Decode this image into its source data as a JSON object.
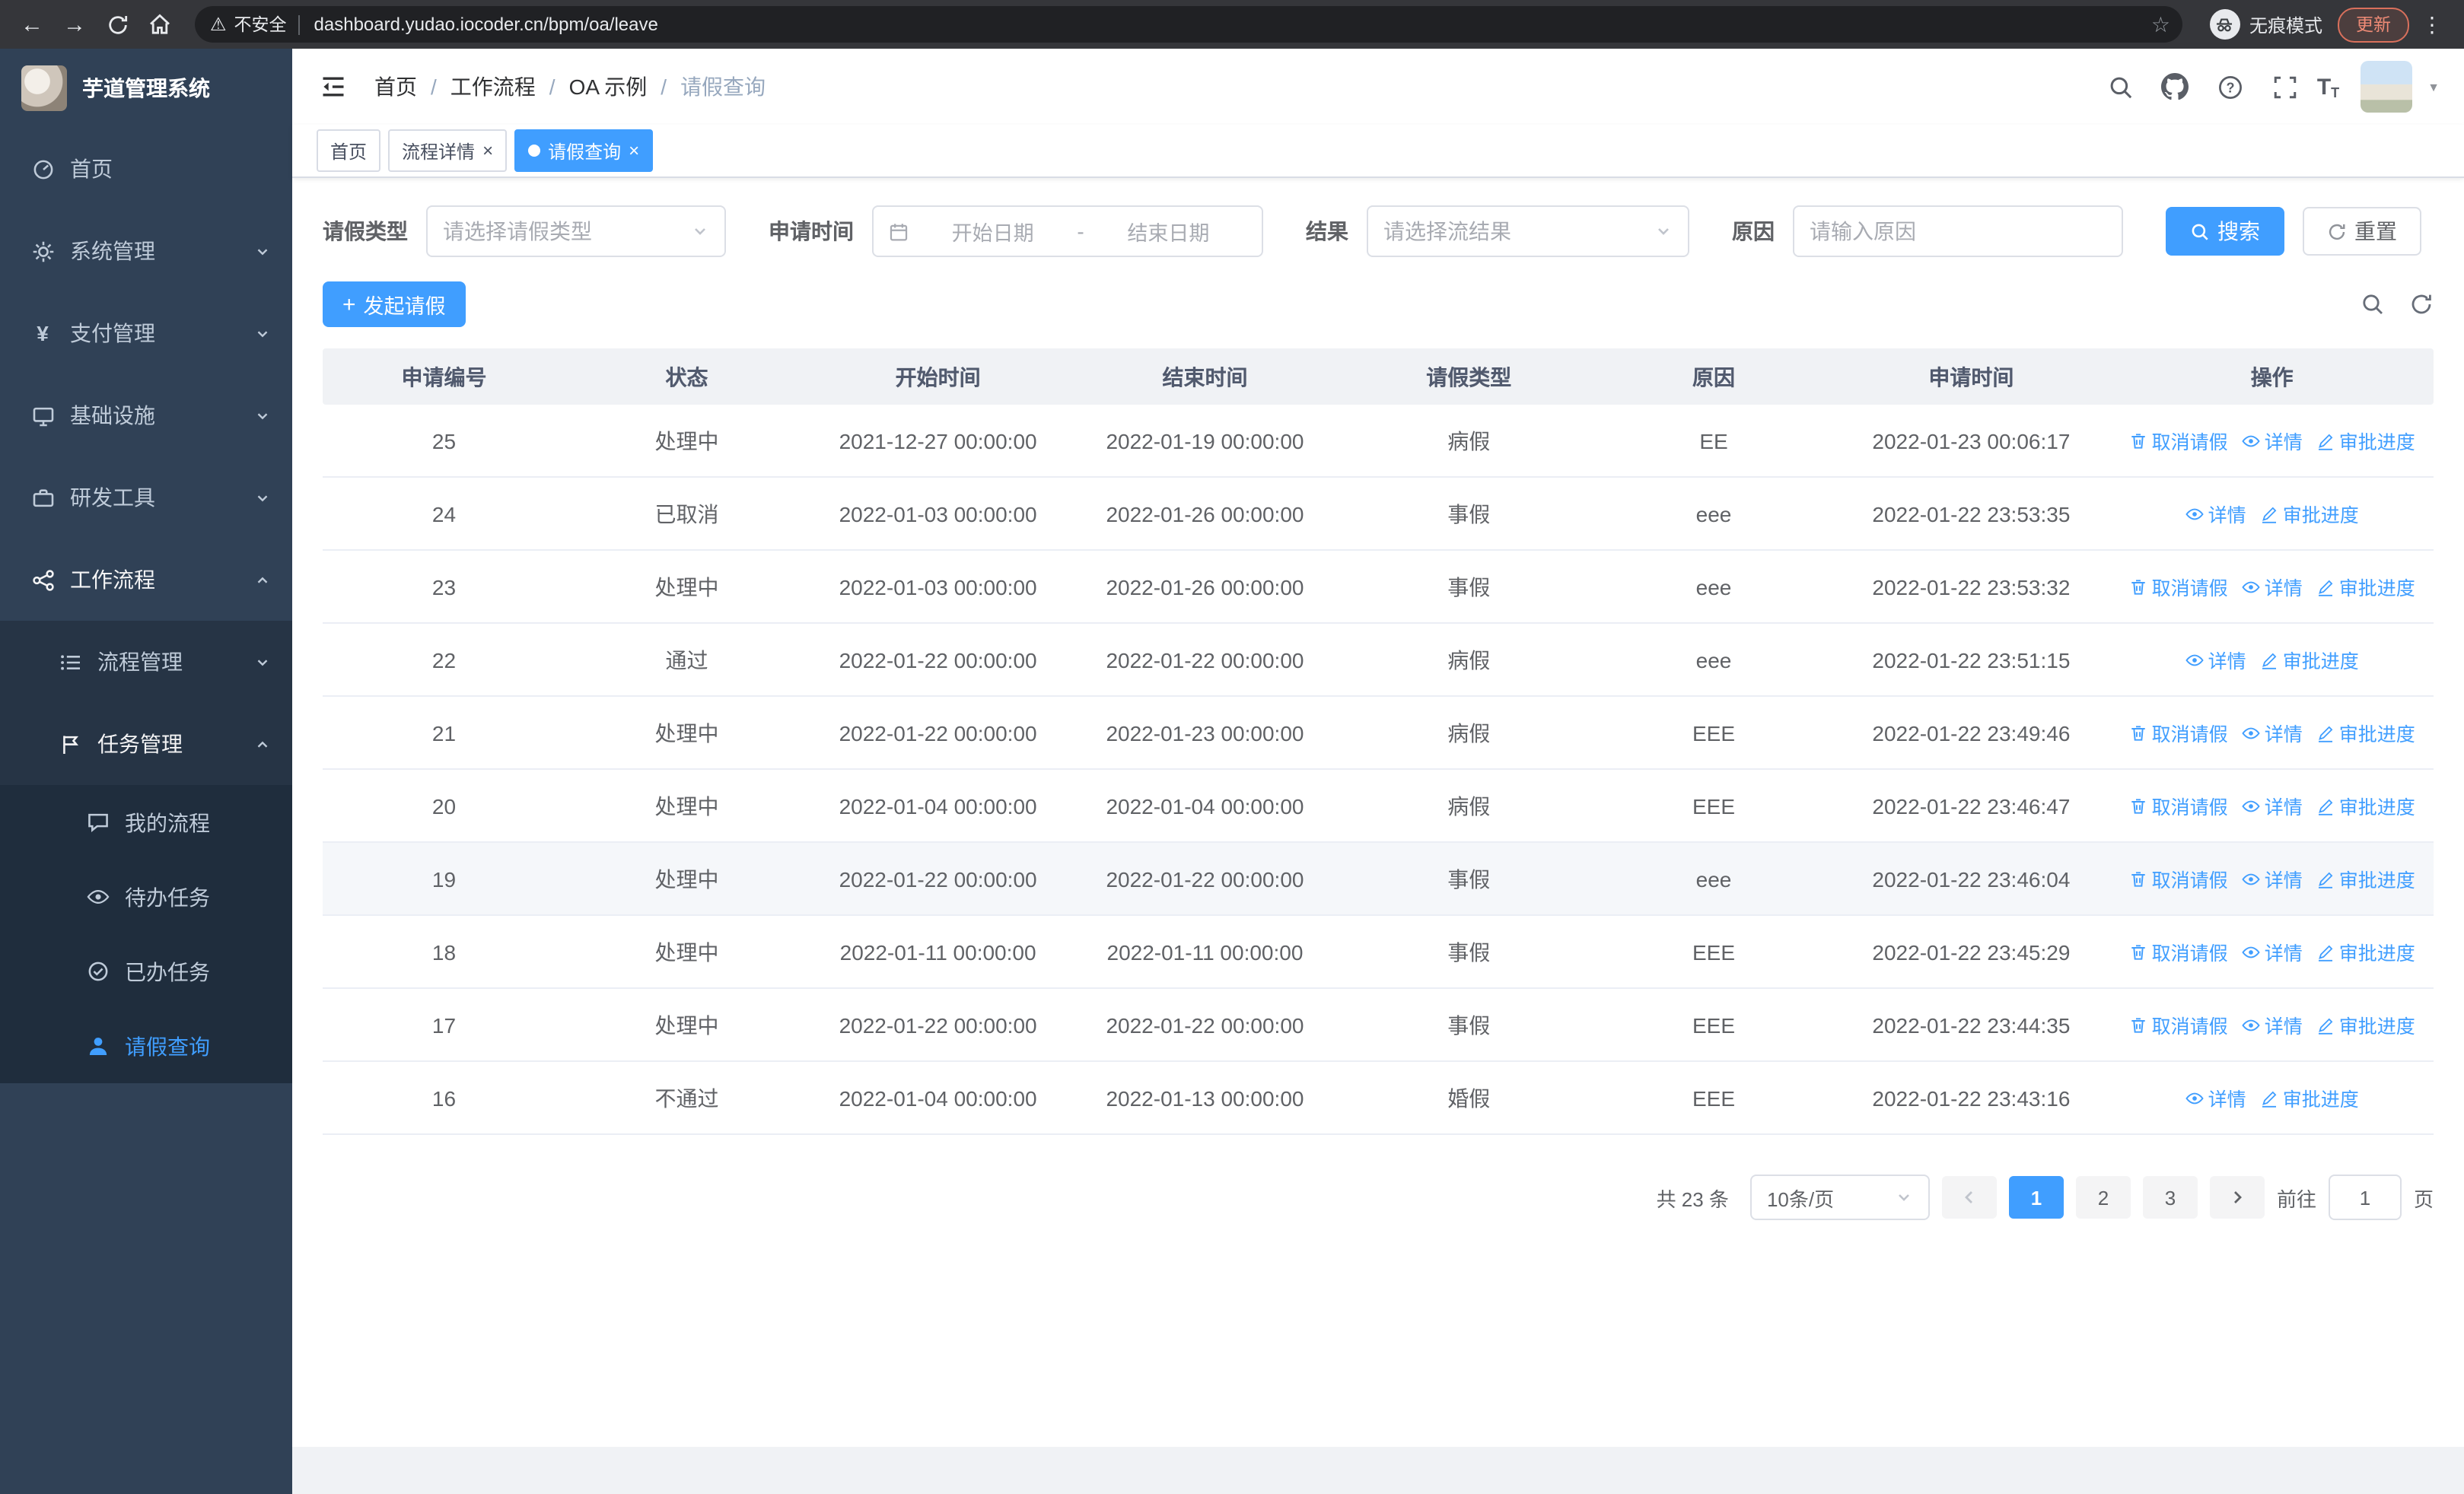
{
  "browser": {
    "security_label": "不安全",
    "url": "dashboard.yudao.iocoder.cn/bpm/oa/leave",
    "incognito_label": "无痕模式",
    "update_label": "更新"
  },
  "sidebar": {
    "logo_title": "芋道管理系统",
    "items": [
      {
        "label": "首页",
        "icon": "dashboard-icon"
      },
      {
        "label": "系统管理",
        "icon": "gear-icon"
      },
      {
        "label": "支付管理",
        "icon": "yen-icon"
      },
      {
        "label": "基础设施",
        "icon": "monitor-icon"
      },
      {
        "label": "研发工具",
        "icon": "briefcase-icon"
      },
      {
        "label": "工作流程",
        "icon": "workflow-icon"
      }
    ],
    "workflow_children": [
      {
        "label": "流程管理",
        "icon": "list-icon"
      },
      {
        "label": "任务管理",
        "icon": "flag-icon"
      }
    ],
    "task_children": [
      {
        "label": "我的流程",
        "icon": "chat-icon"
      },
      {
        "label": "待办任务",
        "icon": "eye-icon"
      },
      {
        "label": "已办任务",
        "icon": "check-circle-icon"
      },
      {
        "label": "请假查询",
        "icon": "user-icon"
      }
    ]
  },
  "header": {
    "breadcrumb": [
      "首页",
      "工作流程",
      "OA 示例",
      "请假查询"
    ]
  },
  "tabs": [
    {
      "label": "首页"
    },
    {
      "label": "流程详情"
    },
    {
      "label": "请假查询"
    }
  ],
  "filters": {
    "leave_type_label": "请假类型",
    "leave_type_placeholder": "请选择请假类型",
    "apply_time_label": "申请时间",
    "start_date_placeholder": "开始日期",
    "range_separator": "-",
    "end_date_placeholder": "结束日期",
    "result_label": "结果",
    "result_placeholder": "请选择流结果",
    "reason_label": "原因",
    "reason_placeholder": "请输入原因",
    "search_button": "搜索",
    "reset_button": "重置"
  },
  "toolbar": {
    "create_button": "发起请假"
  },
  "table": {
    "columns": [
      "申请编号",
      "状态",
      "开始时间",
      "结束时间",
      "请假类型",
      "原因",
      "申请时间",
      "操作"
    ],
    "actions": {
      "cancel": "取消请假",
      "detail": "详情",
      "progress": "审批进度"
    },
    "rows": [
      {
        "id": "25",
        "status": "处理中",
        "start": "2021-12-27 00:00:00",
        "end": "2022-01-19 00:00:00",
        "type": "病假",
        "reason": "EE",
        "apply_time": "2022-01-23 00:06:17",
        "cancelable": true,
        "hover": false
      },
      {
        "id": "24",
        "status": "已取消",
        "start": "2022-01-03 00:00:00",
        "end": "2022-01-26 00:00:00",
        "type": "事假",
        "reason": "eee",
        "apply_time": "2022-01-22 23:53:35",
        "cancelable": false,
        "hover": false
      },
      {
        "id": "23",
        "status": "处理中",
        "start": "2022-01-03 00:00:00",
        "end": "2022-01-26 00:00:00",
        "type": "事假",
        "reason": "eee",
        "apply_time": "2022-01-22 23:53:32",
        "cancelable": true,
        "hover": false
      },
      {
        "id": "22",
        "status": "通过",
        "start": "2022-01-22 00:00:00",
        "end": "2022-01-22 00:00:00",
        "type": "病假",
        "reason": "eee",
        "apply_time": "2022-01-22 23:51:15",
        "cancelable": false,
        "hover": false
      },
      {
        "id": "21",
        "status": "处理中",
        "start": "2022-01-22 00:00:00",
        "end": "2022-01-23 00:00:00",
        "type": "病假",
        "reason": "EEE",
        "apply_time": "2022-01-22 23:49:46",
        "cancelable": true,
        "hover": false
      },
      {
        "id": "20",
        "status": "处理中",
        "start": "2022-01-04 00:00:00",
        "end": "2022-01-04 00:00:00",
        "type": "病假",
        "reason": "EEE",
        "apply_time": "2022-01-22 23:46:47",
        "cancelable": true,
        "hover": false
      },
      {
        "id": "19",
        "status": "处理中",
        "start": "2022-01-22 00:00:00",
        "end": "2022-01-22 00:00:00",
        "type": "事假",
        "reason": "eee",
        "apply_time": "2022-01-22 23:46:04",
        "cancelable": true,
        "hover": true
      },
      {
        "id": "18",
        "status": "处理中",
        "start": "2022-01-11 00:00:00",
        "end": "2022-01-11 00:00:00",
        "type": "事假",
        "reason": "EEE",
        "apply_time": "2022-01-22 23:45:29",
        "cancelable": true,
        "hover": false
      },
      {
        "id": "17",
        "status": "处理中",
        "start": "2022-01-22 00:00:00",
        "end": "2022-01-22 00:00:00",
        "type": "事假",
        "reason": "EEE",
        "apply_time": "2022-01-22 23:44:35",
        "cancelable": true,
        "hover": false
      },
      {
        "id": "16",
        "status": "不通过",
        "start": "2022-01-04 00:00:00",
        "end": "2022-01-13 00:00:00",
        "type": "婚假",
        "reason": "EEE",
        "apply_time": "2022-01-22 23:43:16",
        "cancelable": false,
        "hover": false
      }
    ]
  },
  "pagination": {
    "total_text": "共 23 条",
    "page_size": "10条/页",
    "pages": [
      "1",
      "2",
      "3"
    ],
    "active_page": "1",
    "goto_label": "前往",
    "goto_value": "1",
    "page_suffix": "页"
  },
  "colors": {
    "primary": "#409eff",
    "sidebar_bg": "#304156",
    "sidebar_sub_bg": "#1f2d3d",
    "link": "#409eff"
  }
}
